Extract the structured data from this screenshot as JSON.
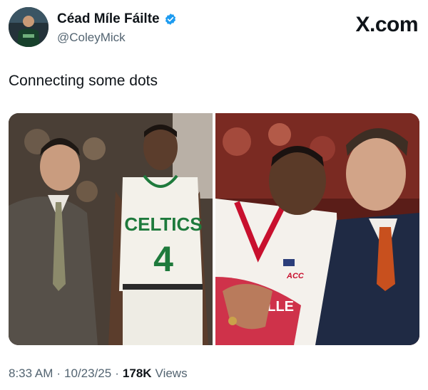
{
  "post": {
    "author": {
      "display_name": "Céad Míle Fáilte",
      "handle": "@ColeyMick",
      "verified": true
    },
    "brand": "X.com",
    "text": "Connecting some dots",
    "media": {
      "left_jersey_team": "CELTICS",
      "left_jersey_number": "4",
      "right_jersey_text": "ACC",
      "right_jersey_chest": "UISVILLE"
    },
    "meta": {
      "time": "8:33 AM",
      "date": "10/23/25",
      "separator": "·",
      "views_count": "178K",
      "views_label": "Views"
    }
  },
  "colors": {
    "verified_blue": "#1d9bf0",
    "celtics_green": "#1e7a3c",
    "cardinal_red": "#c8102e"
  }
}
